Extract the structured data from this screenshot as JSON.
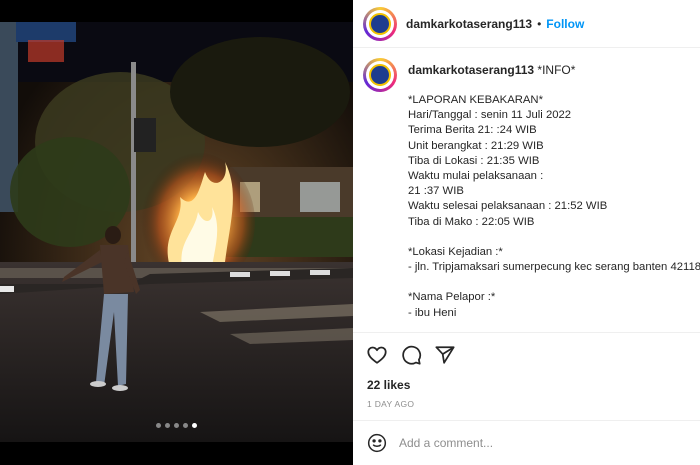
{
  "post": {
    "username": "damkarkotaserang113",
    "separator": "•",
    "follow_label": "Follow",
    "caption_title": "*INFO*",
    "caption_lines": [
      "*LAPORAN KEBAKARAN*",
      "Hari/Tanggal : senin 11 Juli 2022",
      "Terima Berita 21: :24 WIB",
      "Unit berangkat : 21:29 WIB",
      "Tiba di Lokasi : 21:35 WIB",
      "Waktu mulai pelaksanaan :",
      "21 :37 WIB",
      "Waktu selesai pelaksanaan : 21:52 WIB",
      "Tiba di Mako : 22:05 WIB",
      "",
      "*Lokasi Kejadian :*",
      "- jln. Tripjamaksari sumerpecung kec serang banten 42118",
      "",
      "*Nama Pelapor :*",
      "- ibu Heni"
    ],
    "likes": "22 likes",
    "timestamp": "1 DAY AGO",
    "comment_placeholder": "Add a comment..."
  },
  "carousel": {
    "count": 5,
    "active_index": 4
  },
  "icons": {
    "like": "heart-icon",
    "comment": "comment-icon",
    "share": "send-icon",
    "emoji": "emoji-icon"
  },
  "colors": {
    "follow": "#0095f6",
    "text": "#262626",
    "muted": "#8e8e8e",
    "fire": "#ffb347"
  }
}
